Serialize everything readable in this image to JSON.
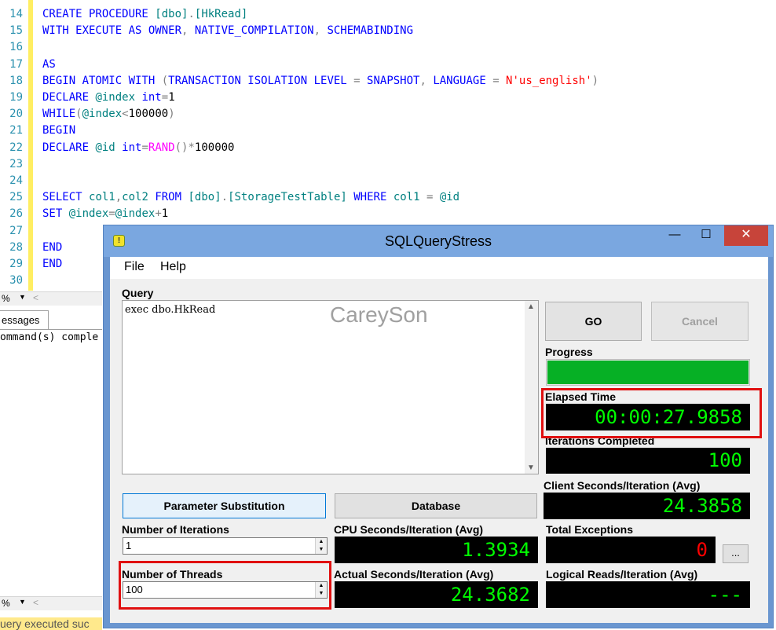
{
  "editor": {
    "lines": [
      {
        "n": "14",
        "seg": [
          [
            "kw",
            "CREATE PROCEDURE "
          ],
          [
            "id",
            "[dbo]"
          ],
          [
            "gr",
            "."
          ],
          [
            "id",
            "[HkRead]"
          ]
        ]
      },
      {
        "n": "15",
        "seg": [
          [
            "kw",
            "WITH EXECUTE AS OWNER"
          ],
          [
            "gr",
            ", "
          ],
          [
            "kw",
            "NATIVE_COMPILATION"
          ],
          [
            "gr",
            ", "
          ],
          [
            "kw",
            "SCHEMABINDING"
          ]
        ]
      },
      {
        "n": "16",
        "seg": []
      },
      {
        "n": "17",
        "seg": [
          [
            "kw",
            "AS"
          ]
        ]
      },
      {
        "n": "18",
        "seg": [
          [
            "kw",
            "BEGIN ATOMIC WITH "
          ],
          [
            "gr",
            "("
          ],
          [
            "kw",
            "TRANSACTION ISOLATION LEVEL "
          ],
          [
            "gr",
            "= "
          ],
          [
            "kw",
            "SNAPSHOT"
          ],
          [
            "gr",
            ", "
          ],
          [
            "kw",
            "LANGUAGE "
          ],
          [
            "gr",
            "= "
          ],
          [
            "str",
            "N'us_english'"
          ],
          [
            "gr",
            ")"
          ]
        ]
      },
      {
        "n": "19",
        "seg": [
          [
            "kw",
            "DECLARE "
          ],
          [
            "id",
            "@index "
          ],
          [
            "kw",
            "int"
          ],
          [
            "gr",
            "="
          ],
          [
            "tx",
            "1"
          ]
        ]
      },
      {
        "n": "20",
        "seg": [
          [
            "kw",
            "WHILE"
          ],
          [
            "gr",
            "("
          ],
          [
            "id",
            "@index"
          ],
          [
            "gr",
            "<"
          ],
          [
            "tx",
            "100000"
          ],
          [
            "gr",
            ")"
          ]
        ]
      },
      {
        "n": "21",
        "seg": [
          [
            "kw",
            "BEGIN"
          ]
        ]
      },
      {
        "n": "22",
        "seg": [
          [
            "kw",
            "DECLARE "
          ],
          [
            "id",
            "@id "
          ],
          [
            "kw",
            "int"
          ],
          [
            "gr",
            "="
          ],
          [
            "fn",
            "RAND"
          ],
          [
            "gr",
            "()*"
          ],
          [
            "tx",
            "100000"
          ]
        ]
      },
      {
        "n": "23",
        "seg": []
      },
      {
        "n": "24",
        "seg": []
      },
      {
        "n": "25",
        "seg": [
          [
            "kw",
            "SELECT "
          ],
          [
            "id",
            "col1"
          ],
          [
            "gr",
            ","
          ],
          [
            "id",
            "col2 "
          ],
          [
            "kw",
            "FROM "
          ],
          [
            "id",
            "[dbo]"
          ],
          [
            "gr",
            "."
          ],
          [
            "id",
            "[StorageTestTable] "
          ],
          [
            "kw",
            "WHERE "
          ],
          [
            "id",
            "col1 "
          ],
          [
            "gr",
            "= "
          ],
          [
            "id",
            "@id"
          ]
        ]
      },
      {
        "n": "26",
        "seg": [
          [
            "kw",
            "SET "
          ],
          [
            "id",
            "@index"
          ],
          [
            "gr",
            "="
          ],
          [
            "id",
            "@index"
          ],
          [
            "gr",
            "+"
          ],
          [
            "tx",
            "1"
          ]
        ]
      },
      {
        "n": "27",
        "seg": []
      },
      {
        "n": "28",
        "seg": [
          [
            "kw",
            "END"
          ]
        ]
      },
      {
        "n": "29",
        "seg": [
          [
            "kw",
            "END"
          ]
        ]
      },
      {
        "n": "30",
        "seg": []
      }
    ],
    "zoom": "%",
    "messages_tab": "essages",
    "messages_text": "ommand(s) comple",
    "status_text": "uery executed suc"
  },
  "window": {
    "title": "SQLQueryStress",
    "menu": [
      "File",
      "Help"
    ],
    "query_label": "Query",
    "query_text": "exec dbo.HkRead",
    "watermark": "CareySon",
    "go_label": "GO",
    "cancel_label": "Cancel",
    "progress_label": "Progress",
    "progress_fraction": 1.0,
    "elapsed_label": "Elapsed Time",
    "elapsed_value": "00:00:27.9858",
    "iterations_completed_label": "Iterations Completed",
    "iterations_completed_value": "100",
    "client_seconds_label": "Client Seconds/Iteration (Avg)",
    "client_seconds_value": "24.3858",
    "param_sub_label": "Parameter Substitution",
    "database_label": "Database",
    "num_iterations_label": "Number of Iterations",
    "num_iterations_value": "1",
    "cpu_seconds_label": "CPU Seconds/Iteration (Avg)",
    "cpu_seconds_value": "1.3934",
    "total_exceptions_label": "Total Exceptions",
    "total_exceptions_value": "0",
    "ellipsis_label": "...",
    "num_threads_label": "Number of Threads",
    "num_threads_value": "100",
    "actual_seconds_label": "Actual Seconds/Iteration (Avg)",
    "actual_seconds_value": "24.3682",
    "logical_reads_label": "Logical Reads/Iteration (Avg)",
    "logical_reads_value": "---",
    "colors": {
      "digital_green": "#00ff00",
      "digital_red": "#ff0000",
      "progress_green": "#06b025",
      "highlight_red": "#e01010"
    }
  }
}
